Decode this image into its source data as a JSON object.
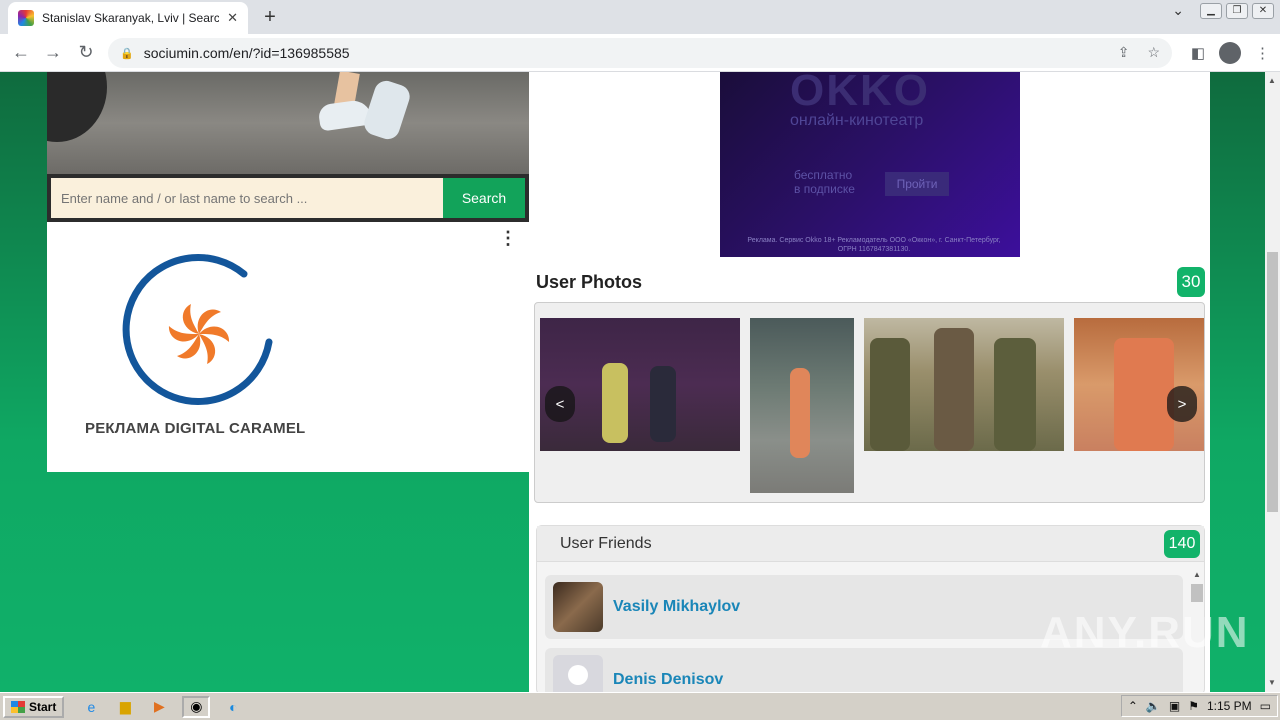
{
  "browser": {
    "tab_title": "Stanislav Skaranyak, Lviv | Search In",
    "url": "sociumin.com/en/?id=136985585"
  },
  "search": {
    "placeholder": "Enter name and / or last name to search ...",
    "button_label": "Search"
  },
  "left_ad": {
    "text": "РЕКЛАМА DIGITAL CARAMEL",
    "menu_icon": "⋮"
  },
  "right_ad": {
    "brand": "OKKO",
    "tagline": "онлайн-кинотеатр",
    "offer_line1": "бесплатно",
    "offer_line2": "в подписке",
    "cta": "Пройти",
    "legal": "Реклама. Сервис Okko 18+ Рекламодатель ООО «Оккон», г. Санкт-Петербург, ОГРН 1167847381130."
  },
  "photos": {
    "title": "User Photos",
    "count": "30",
    "prev": "<",
    "next": ">"
  },
  "friends": {
    "title": "User Friends",
    "count": "140",
    "items": [
      {
        "name": "Vasily Mikhaylov"
      },
      {
        "name": "Denis Denisov"
      }
    ]
  },
  "watermark": "ANY.RUN",
  "taskbar": {
    "start_label": "Start",
    "clock": "1:15 PM"
  }
}
